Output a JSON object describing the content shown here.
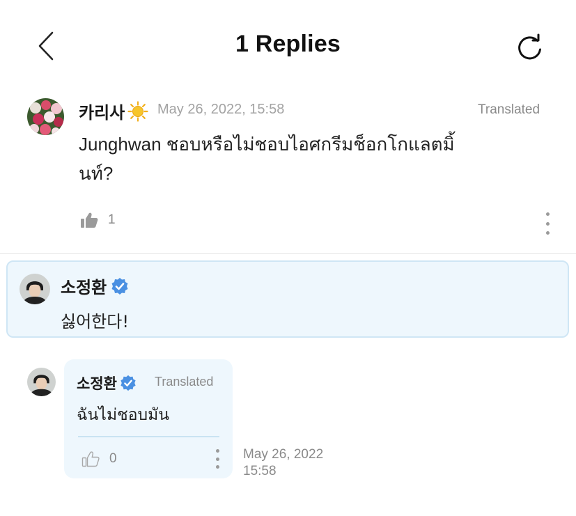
{
  "header": {
    "title": "1 Replies",
    "back_icon": "chevron-left-icon",
    "refresh_icon": "refresh-icon"
  },
  "comment": {
    "author": "카리사",
    "badge_icon": "sun-icon",
    "date": "May 26, 2022, 15:58",
    "translated_label": "Translated",
    "text": "Junghwan ชอบหรือไม่ชอบไอศกรีมช็อกโกแลตมิ้นท์?",
    "likes": "1"
  },
  "highlighted_reply": {
    "author": "소정환",
    "verified_icon": "verified-badge-icon",
    "text": "싫어한다!"
  },
  "translated_reply": {
    "author": "소정환",
    "translated_label": "Translated",
    "text": "ฉันไม่ชอบมัน",
    "likes": "0",
    "date": "May 26, 2022",
    "time": "15:58"
  },
  "colors": {
    "accent_blue": "#4a90e2",
    "bubble_bg": "#eef7fd",
    "muted_text": "#8a8a8a"
  }
}
